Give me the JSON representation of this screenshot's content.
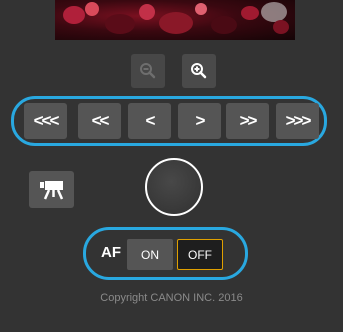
{
  "zoom": {
    "out_icon": "zoom-out-icon",
    "in_icon": "zoom-in-icon"
  },
  "navigation": {
    "buttons": [
      {
        "label": "<<<",
        "icon": "jump-back-large-icon"
      },
      {
        "label": "<<",
        "icon": "jump-back-medium-icon"
      },
      {
        "label": "<",
        "icon": "step-back-icon"
      },
      {
        "label": ">",
        "icon": "step-forward-icon"
      },
      {
        "label": ">>",
        "icon": "jump-forward-medium-icon"
      },
      {
        "label": ">>>",
        "icon": "jump-forward-large-icon"
      }
    ]
  },
  "movie_button": {
    "icon": "movie-camera-icon"
  },
  "af": {
    "label": "AF",
    "on_label": "ON",
    "off_label": "OFF",
    "selected": "OFF"
  },
  "footer": {
    "copyright": "Copyright CANON INC. 2016"
  },
  "colors": {
    "panel_bg": "#333333",
    "highlight_ring": "#29a8e0",
    "button_bg": "#555555",
    "selected_border": "#e0a000",
    "copyright_text": "#8a8a8a"
  }
}
